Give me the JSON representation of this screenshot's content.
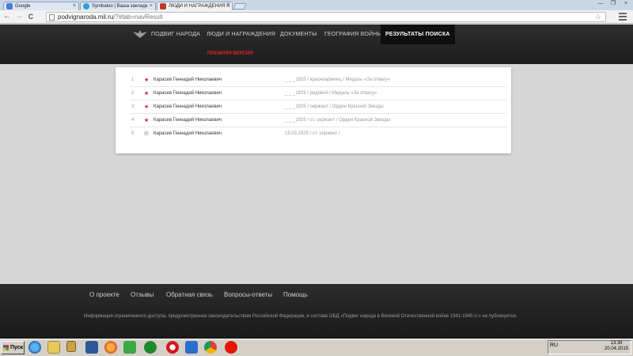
{
  "browser": {
    "tabs": [
      {
        "label": "Google",
        "favicon_color": "#4a7fd8"
      },
      {
        "label": "Symbaloo | Ваша закладк",
        "favicon_color": "#2b9fd9"
      },
      {
        "label": "ЛЮДИ И НАГРАЖДЕНИЯ П",
        "favicon_color": "#c0392b"
      }
    ],
    "close_symbol": "×",
    "address_host": "podvignaroda.mil.ru",
    "address_path": "/?#tab=navResult",
    "back_icon": "←",
    "forward_icon": "→",
    "reload_icon": "C",
    "star_icon": "☆",
    "window_controls": [
      "—",
      "❐",
      "×"
    ]
  },
  "site": {
    "nav": [
      {
        "label": "ПОДВИГ НАРОДА",
        "active": false
      },
      {
        "label": "ЛЮДИ И НАГРАЖДЕНИЯ",
        "active": false
      },
      {
        "label": "ДОКУМЕНТЫ",
        "active": false
      },
      {
        "label": "ГЕОГРАФИЯ ВОЙНЫ",
        "active": false
      },
      {
        "label": "РЕЗУЛЬТАТЫ ПОИСКА",
        "active": true
      }
    ],
    "prev_version": "ПРЕЖНЯЯ ВЕРСИЯ",
    "results": [
      {
        "num": "1",
        "mark": "star",
        "name": "Карасев Геннадий Николаевич",
        "info": "_ _ _1925 /  красноармеец /  Медаль «За отвагу»"
      },
      {
        "num": "2",
        "mark": "star",
        "name": "Карасев Геннадий Николаевич",
        "info": "_ _ _1925 /  рядовой /  Медаль «За отвагу»"
      },
      {
        "num": "3",
        "mark": "star",
        "name": "Карасев Геннадий Николаевич",
        "info": "_ _ _1925 /  сержант /  Орден Красной Звезды"
      },
      {
        "num": "4",
        "mark": "star",
        "name": "Карасев Геннадий Николаевич",
        "info": "_ _ _1925 /  ст. сержант /  Орден Красной Звезды"
      },
      {
        "num": "5",
        "mark": "document",
        "name": "Карасев Геннадий Николаевич",
        "info": "15.03.1925 /  ст. сержант /  ."
      }
    ],
    "footer_links": [
      "О проекте",
      "Отзывы",
      "Обратная связь",
      "Вопросы-ответы",
      "Помощь"
    ],
    "footer_note": "Информация ограниченного доступа, предусмотренная законодательством Российской Федерации, в составе ОБД «Подвиг народа в Великой Отечественной войне 1941-1945 гг.» не публикуется."
  },
  "taskbar": {
    "start_label": "Пуск",
    "language": "RU",
    "time": "13:39",
    "date": "20.04.2015"
  },
  "colors": {
    "accent_red": "#dd2222",
    "header_dark": "#2b2b2b"
  }
}
